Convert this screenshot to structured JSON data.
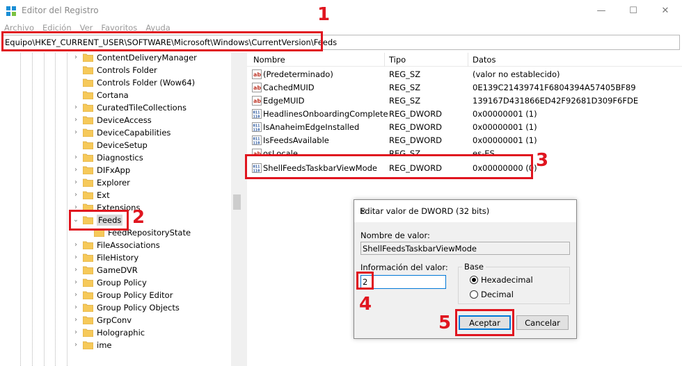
{
  "window": {
    "title": "Editor del Registro",
    "minimize_symbol": "—",
    "maximize_symbol": "☐",
    "close_symbol": "✕"
  },
  "menu": [
    "Archivo",
    "Edición",
    "Ver",
    "Favoritos",
    "Ayuda"
  ],
  "address": "Equipo\\HKEY_CURRENT_USER\\SOFTWARE\\Microsoft\\Windows\\CurrentVersion\\Feeds",
  "tree": {
    "items": [
      {
        "label": "ContentDeliveryManager",
        "expander": "›"
      },
      {
        "label": "Controls Folder",
        "expander": ""
      },
      {
        "label": "Controls Folder (Wow64)",
        "expander": ""
      },
      {
        "label": "Cortana",
        "expander": ""
      },
      {
        "label": "CuratedTileCollections",
        "expander": "›"
      },
      {
        "label": "DeviceAccess",
        "expander": "›"
      },
      {
        "label": "DeviceCapabilities",
        "expander": "›"
      },
      {
        "label": "DeviceSetup",
        "expander": ""
      },
      {
        "label": "Diagnostics",
        "expander": "›"
      },
      {
        "label": "DIFxApp",
        "expander": "›"
      },
      {
        "label": "Explorer",
        "expander": "›"
      },
      {
        "label": "Ext",
        "expander": "›"
      },
      {
        "label": "Extensions",
        "expander": "›"
      },
      {
        "label": "Feeds",
        "expander": "⌄",
        "selected": true
      },
      {
        "label": "FeedRepositoryState",
        "expander": "",
        "child": true
      },
      {
        "label": "FileAssociations",
        "expander": "›"
      },
      {
        "label": "FileHistory",
        "expander": "›"
      },
      {
        "label": "GameDVR",
        "expander": "›"
      },
      {
        "label": "Group Policy",
        "expander": "›"
      },
      {
        "label": "Group Policy Editor",
        "expander": "›"
      },
      {
        "label": "Group Policy Objects",
        "expander": "›"
      },
      {
        "label": "GrpConv",
        "expander": "›"
      },
      {
        "label": "Holographic",
        "expander": "›"
      },
      {
        "label": "ime",
        "expander": "›"
      }
    ]
  },
  "list": {
    "headers": {
      "name": "Nombre",
      "type": "Tipo",
      "data": "Datos"
    },
    "rows": [
      {
        "name": "(Predeterminado)",
        "type": "REG_SZ",
        "data": "(valor no establecido)",
        "icon": "string-value-icon"
      },
      {
        "name": "CachedMUID",
        "type": "REG_SZ",
        "data": "0E139C21439741F6804394A57405BF89",
        "icon": "string-value-icon"
      },
      {
        "name": "EdgeMUID",
        "type": "REG_SZ",
        "data": "139167D431866ED42F92681D309F6FDE",
        "icon": "string-value-icon"
      },
      {
        "name": "HeadlinesOnboardingComplete",
        "type": "REG_DWORD",
        "data": "0x00000001 (1)",
        "icon": "dword-value-icon"
      },
      {
        "name": "IsAnaheimEdgeInstalled",
        "type": "REG_DWORD",
        "data": "0x00000001 (1)",
        "icon": "dword-value-icon"
      },
      {
        "name": "IsFeedsAvailable",
        "type": "REG_DWORD",
        "data": "0x00000001 (1)",
        "icon": "dword-value-icon"
      },
      {
        "name": "osLocale",
        "type": "REG_SZ",
        "data": "es-ES",
        "icon": "string-value-icon"
      },
      {
        "name": "ShellFeedsTaskbarViewMode",
        "type": "REG_DWORD",
        "data": "0x00000000 (0)",
        "icon": "dword-value-icon"
      }
    ]
  },
  "dialog": {
    "title": "Editar valor de DWORD (32 bits)",
    "close_symbol": "✕",
    "name_label": "Nombre de valor:",
    "name_value": "ShellFeedsTaskbarViewMode",
    "value_label": "Información del valor:",
    "value": "2",
    "base_label": "Base",
    "base_options": [
      {
        "label": "Hexadecimal",
        "selected": true
      },
      {
        "label": "Decimal",
        "selected": false
      }
    ],
    "ok_label": "Aceptar",
    "cancel_label": "Cancelar"
  },
  "annotations": {
    "step1": "1",
    "step2": "2",
    "step3": "3",
    "step4": "4",
    "step5": "5",
    "color": "#e0151f"
  },
  "colors": {
    "folder": "#f6c95a",
    "selection": "#d9d9d9",
    "accent": "#0078d7",
    "string_icon_red": "#c0392b",
    "dword_icon_blue": "#1f4e99"
  }
}
